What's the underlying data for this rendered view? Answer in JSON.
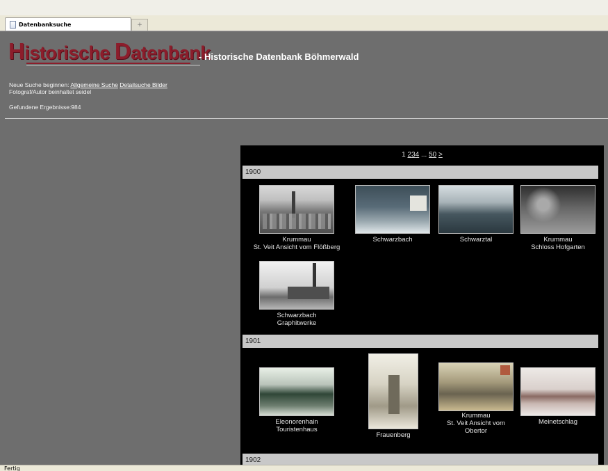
{
  "browser": {
    "tab_title": "Datenbanksuche",
    "new_tab_label": "+",
    "status_text": "Fertig"
  },
  "header": {
    "logo_text": "Historische Datenbank",
    "logo_first_cap": "H",
    "logo_mid": "istorische ",
    "logo_second_cap": "D",
    "logo_end": "atenbank",
    "site_title": "- Historische Datenbank Böhmerwald"
  },
  "search_info": {
    "new_search_prefix": "Neue Suche beginnen: ",
    "general_search_link": "Allgemeine Suche",
    "detail_search_link": "Detailsuche Bilder",
    "filter_text": "Fotograf/Autor beinhaltet seidel",
    "results_text": "Gefundene Ergebnisse:984"
  },
  "pager": {
    "current": "1",
    "pages": [
      "2",
      "3",
      "4"
    ],
    "ellipsis": "...",
    "last": "50",
    "next": ">"
  },
  "years": [
    {
      "year": "1900",
      "items": [
        {
          "caption": [
            "Krummau",
            "St. Veit Ansicht vom Flößberg"
          ],
          "thumb": "city-view"
        },
        {
          "caption": [
            "Schwarzbach"
          ],
          "thumb": "postcard-village"
        },
        {
          "caption": [
            "Schwarztal"
          ],
          "thumb": "landscape-postcard"
        },
        {
          "caption": [
            "Krummau",
            "Schloss Hofgarten"
          ],
          "thumb": "park-trees"
        },
        {
          "caption": [
            "Schwarzbach",
            "Graphitwerke"
          ],
          "thumb": "factory-chimney"
        }
      ]
    },
    {
      "year": "1901",
      "items": [
        {
          "caption": [
            "Eleonorenhain",
            "Touristenhaus"
          ],
          "thumb": "hills-postcard"
        },
        {
          "caption": [
            "Frauenberg"
          ],
          "thumb": "castle-postcard"
        },
        {
          "caption": [
            "Krummau",
            "St. Veit Ansicht vom",
            "Obertor"
          ],
          "thumb": "color-postcard"
        },
        {
          "caption": [
            "Meinetschlag"
          ],
          "thumb": "winter-village"
        }
      ]
    },
    {
      "year": "1902",
      "items": []
    }
  ]
}
